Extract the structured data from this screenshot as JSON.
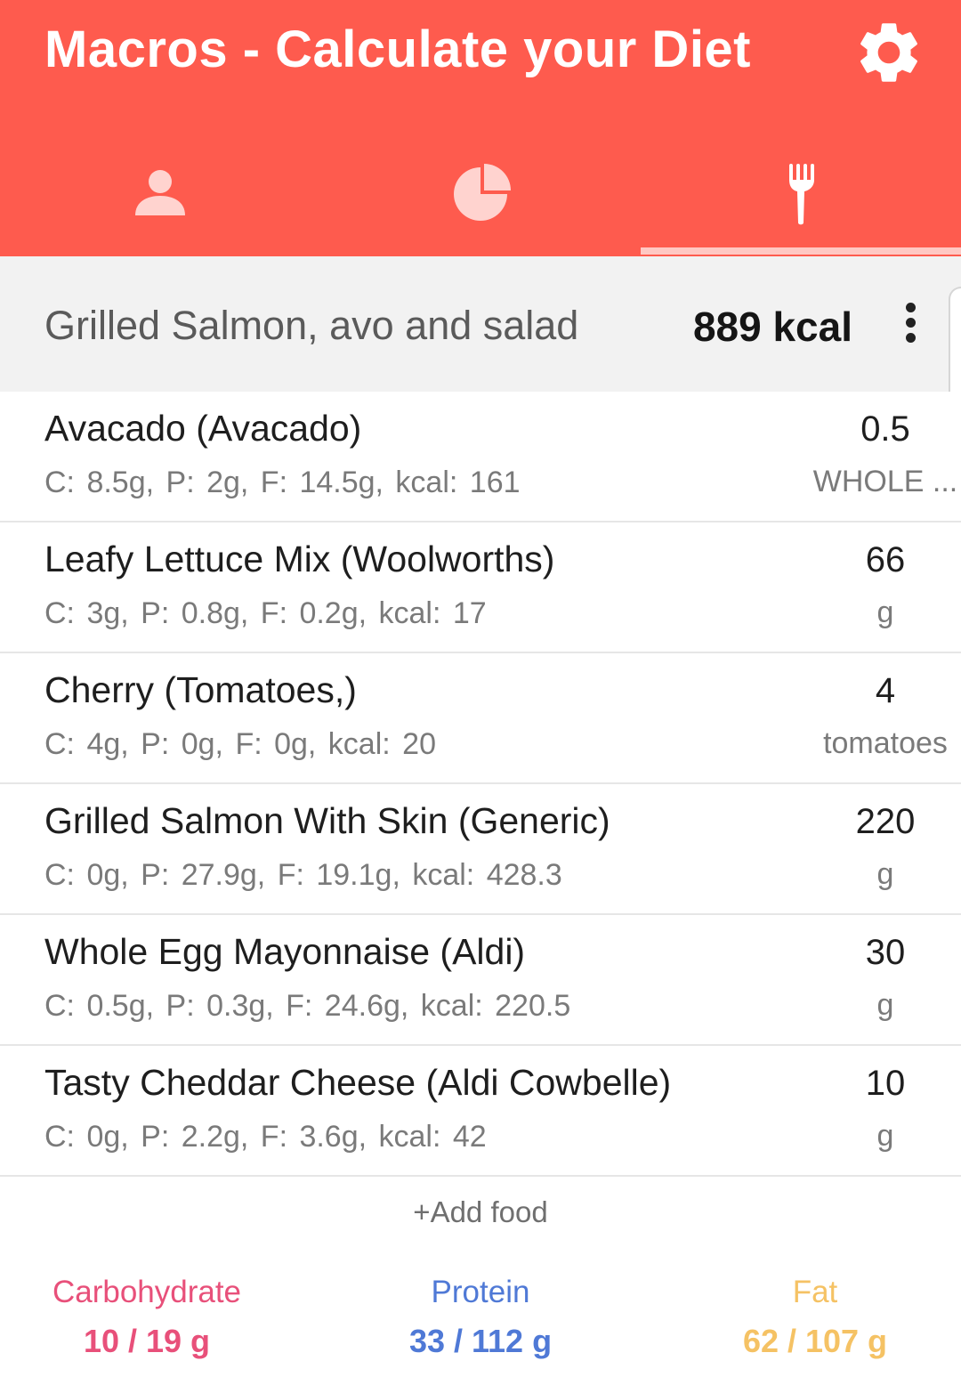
{
  "app": {
    "title": "Macros - Calculate your Diet"
  },
  "icons": {
    "settings": "gear-icon",
    "profile_tab": "person-icon",
    "stats_tab": "pie-chart-icon",
    "food_tab": "fork-icon",
    "menu": "more-vert-icon"
  },
  "colors": {
    "appbar": "#fe5b4e",
    "carbohydrate": "#e8507a",
    "protein": "#4f79d6",
    "fat": "#f5c264"
  },
  "tabs": {
    "active": "food"
  },
  "meal": {
    "name": "Grilled Salmon, avo and salad",
    "kcal": "889 kcal"
  },
  "foods": [
    {
      "name": "Avacado (Avacado)",
      "macros": "C: 8.5g,  P: 2g,  F: 14.5g,  kcal: 161",
      "qty": "0.5",
      "unit": "WHOLE ..."
    },
    {
      "name": "Leafy Lettuce Mix (Woolworths)",
      "macros": "C: 3g,  P: 0.8g,  F: 0.2g,  kcal: 17",
      "qty": "66",
      "unit": "g"
    },
    {
      "name": "Cherry (Tomatoes,)",
      "macros": "C: 4g,  P: 0g,  F: 0g,  kcal: 20",
      "qty": "4",
      "unit": "tomatoes"
    },
    {
      "name": "Grilled Salmon With Skin (Generic)",
      "macros": "C: 0g,  P: 27.9g,  F: 19.1g,  kcal: 428.3",
      "qty": "220",
      "unit": "g"
    },
    {
      "name": "Whole Egg Mayonnaise (Aldi)",
      "macros": "C: 0.5g,  P: 0.3g,  F: 24.6g,  kcal: 220.5",
      "qty": "30",
      "unit": "g"
    },
    {
      "name": "Tasty Cheddar Cheese (Aldi Cowbelle)",
      "macros": "C: 0g,  P: 2.2g,  F: 3.6g,  kcal: 42",
      "qty": "10",
      "unit": "g"
    }
  ],
  "add_food": "+Add food",
  "totals": {
    "carbohydrate": {
      "label": "Carbohydrate",
      "value": "10 / 19 g"
    },
    "protein": {
      "label": "Protein",
      "value": "33 / 112 g"
    },
    "fat": {
      "label": "Fat",
      "value": "62 / 107 g"
    }
  }
}
